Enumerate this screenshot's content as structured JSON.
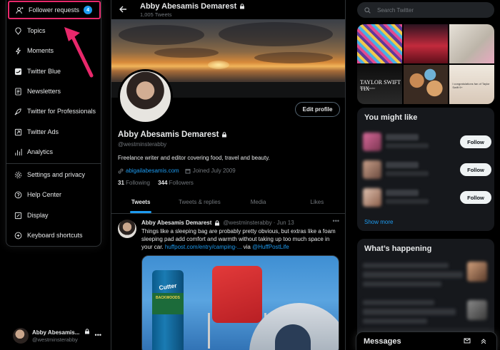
{
  "menu": {
    "follower_requests": {
      "label": "Follower requests",
      "badge": "4"
    },
    "items": [
      {
        "label": "Topics",
        "icon": "topics-icon"
      },
      {
        "label": "Moments",
        "icon": "moments-icon"
      },
      {
        "label": "Twitter Blue",
        "icon": "twitter-blue-icon"
      },
      {
        "label": "Newsletters",
        "icon": "newsletters-icon"
      },
      {
        "label": "Twitter for Professionals",
        "icon": "rocket-icon"
      },
      {
        "label": "Twitter Ads",
        "icon": "ads-icon"
      },
      {
        "label": "Analytics",
        "icon": "analytics-icon"
      }
    ],
    "settings_items": [
      {
        "label": "Settings and privacy",
        "icon": "gear-icon"
      },
      {
        "label": "Help Center",
        "icon": "help-icon"
      },
      {
        "label": "Display",
        "icon": "display-icon"
      },
      {
        "label": "Keyboard shortcuts",
        "icon": "keyboard-icon"
      }
    ]
  },
  "account": {
    "name": "Abby Abesamis...",
    "handle": "@westminsterabby",
    "more": "•••"
  },
  "header": {
    "name": "Abby Abesamis Demarest",
    "tweet_count": "1,005 Tweets"
  },
  "profile": {
    "edit_label": "Edit profile",
    "name": "Abby Abesamis Demarest",
    "handle": "@westminsterabby",
    "bio": "Freelance writer and editor covering food, travel and beauty.",
    "website": "abigailabesamis.com",
    "joined": "Joined July 2009",
    "following_count": "31",
    "following_label": "Following",
    "followers_count": "344",
    "followers_label": "Followers"
  },
  "tabs": [
    "Tweets",
    "Tweets & replies",
    "Media",
    "Likes"
  ],
  "tweet": {
    "name": "Abby Abesamis Demarest",
    "handle": "@westminsterabby · Jun 13",
    "text_main": "Things like a sleeping bag are probably pretty obvious, but extras like a foam sleeping pad add comfort and warmth without taking up too much space in your car.",
    "link": "huffpost.com/entry/camping-...",
    "via": "via",
    "mention": "@HuffPostLife",
    "media": {
      "can_brand": "Cutter",
      "can_sub": "BACKWOODS"
    }
  },
  "search": {
    "placeholder": "Search Twitter"
  },
  "photos": {
    "tile4_title": "TAYLOR SWIFT TIX",
    "tile4_sub": "ticketmaster",
    "tile6_text": "I congratulations fan of Taylor Swift 9+"
  },
  "you_might_like": {
    "title": "You might like",
    "follow_label": "Follow",
    "show_more": "Show more"
  },
  "whats_happening": {
    "title": "What’s happening"
  },
  "messages": {
    "title": "Messages"
  },
  "colors": {
    "accent": "#1d9bf0",
    "highlight": "#e8286b",
    "background": "#000000"
  }
}
